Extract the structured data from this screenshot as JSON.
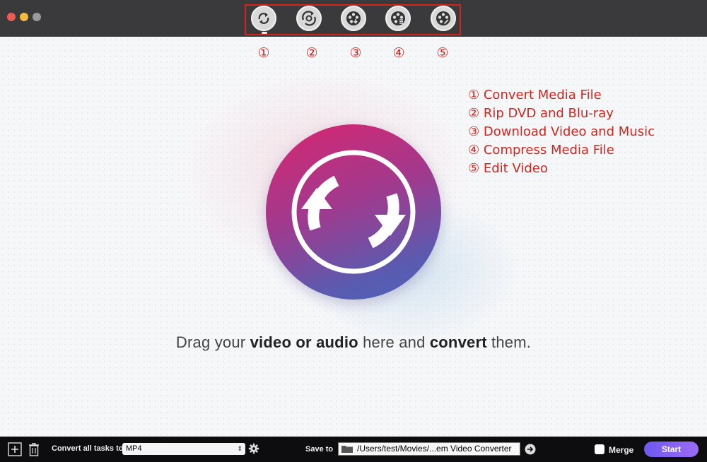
{
  "toolbar": {
    "tools": [
      {
        "id": "convert",
        "icon": "convert-icon"
      },
      {
        "id": "rip",
        "icon": "rip-disc-icon"
      },
      {
        "id": "download",
        "icon": "film-reel-download-icon"
      },
      {
        "id": "compress",
        "icon": "film-reel-compress-icon"
      },
      {
        "id": "edit",
        "icon": "film-reel-edit-icon"
      }
    ],
    "numbers": [
      "①",
      "②",
      "③",
      "④",
      "⑤"
    ]
  },
  "legend": [
    "① Convert Media File",
    "② Rip DVD and Blu-ray",
    "③ Download Video and Music",
    "④ Compress Media File",
    "⑤ Edit Video"
  ],
  "main": {
    "drag_pre": "Drag your ",
    "drag_bold1": "video or audio",
    "drag_mid": " here and ",
    "drag_bold2": "convert",
    "drag_post": " them."
  },
  "bottom": {
    "convert_label": "Convert all tasks to",
    "format_value": "MP4",
    "save_label": "Save to",
    "save_path": "/Users/test/Movies/...em Video Converter",
    "merge_label": "Merge",
    "start_label": "Start"
  },
  "colors": {
    "annotation": "#d6231c",
    "start_button": "#7b5cf2",
    "titlebar": "#3a3a3c"
  }
}
